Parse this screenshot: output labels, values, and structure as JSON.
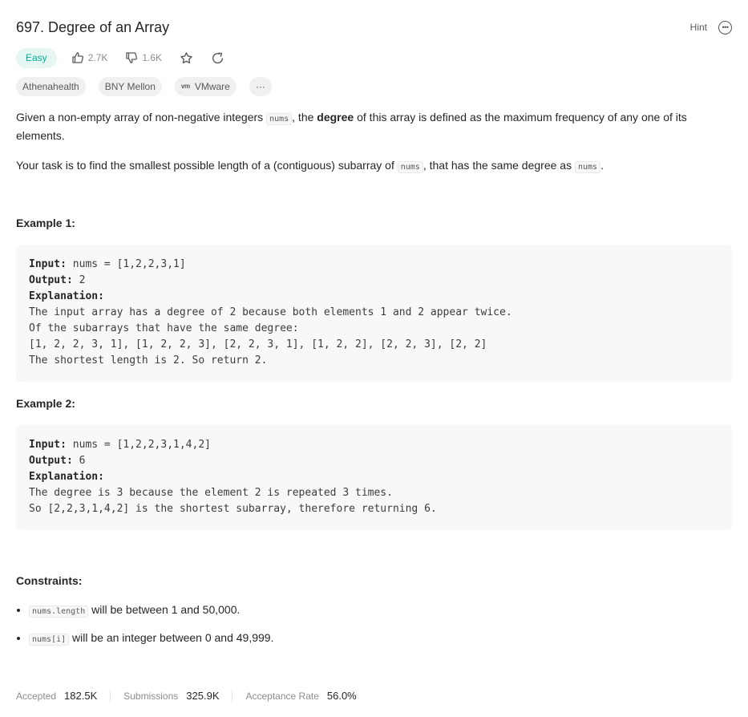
{
  "problem": {
    "title": "697. Degree of an Array",
    "hint_label": "Hint",
    "difficulty": "Easy",
    "likes": "2.7K",
    "dislikes": "1.6K"
  },
  "tags": [
    "Athenahealth",
    "BNY Mellon",
    "VMware"
  ],
  "tag_more": "···",
  "vmware_logo": "vm",
  "description": {
    "p1_a": "Given a non-empty array of non-negative integers ",
    "p1_code": "nums",
    "p1_b": ", the ",
    "p1_bold": "degree",
    "p1_c": " of this array is defined as the maximum frequency of any one of its elements.",
    "p2_a": "Your task is to find the smallest possible length of a (contiguous) subarray of ",
    "p2_code1": "nums",
    "p2_b": ", that has the same degree as ",
    "p2_code2": "nums",
    "p2_c": "."
  },
  "examples": [
    {
      "title": "Example 1:",
      "input_label": "Input:",
      "input": " nums = [1,2,2,3,1]",
      "output_label": "Output:",
      "output": " 2",
      "explanation_label": "Explanation:",
      "explanation_lines": [
        "The input array has a degree of 2 because both elements 1 and 2 appear twice.",
        "Of the subarrays that have the same degree:",
        "[1, 2, 2, 3, 1], [1, 2, 2, 3], [2, 2, 3, 1], [1, 2, 2], [2, 2, 3], [2, 2]",
        "The shortest length is 2. So return 2."
      ]
    },
    {
      "title": "Example 2:",
      "input_label": "Input:",
      "input": " nums = [1,2,2,3,1,4,2]",
      "output_label": "Output:",
      "output": " 6",
      "explanation_label": "Explanation:",
      "explanation_lines": [
        "The degree is 3 because the element 2 is repeated 3 times.",
        "So [2,2,3,1,4,2] is the shortest subarray, therefore returning 6."
      ]
    }
  ],
  "constraints": {
    "title": "Constraints:",
    "items": [
      {
        "code": "nums.length",
        "text": " will be between 1 and 50,000."
      },
      {
        "code": "nums[i]",
        "text": " will be an integer between 0 and 49,999."
      }
    ]
  },
  "stats": {
    "accepted_label": "Accepted",
    "accepted_value": "182.5K",
    "submissions_label": "Submissions",
    "submissions_value": "325.9K",
    "rate_label": "Acceptance Rate",
    "rate_value": "56.0%"
  },
  "colors": {
    "easy": "#00af9b",
    "easy_bg": "#e6f7f3",
    "code_bg": "#f7f8fa"
  }
}
